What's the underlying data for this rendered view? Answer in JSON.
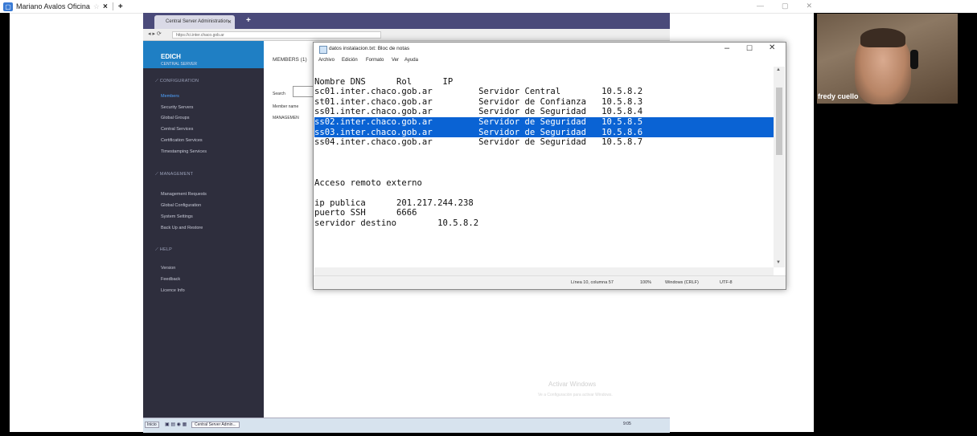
{
  "outer": {
    "tab_title": "Mariano Avalos Oficina",
    "new_tab": "+",
    "close": "×"
  },
  "remote_browser": {
    "tab_title": "Central Server Administration",
    "url": "https://ci.inter.chaco.gob.ar",
    "brand_title": "EDICH",
    "brand_subtitle": "CENTRAL SERVER",
    "sections": [
      {
        "title": "CONFIGURATION",
        "items": [
          "Members",
          "Security Servers",
          "Global Groups",
          "Central Services",
          "Certification Services",
          "Timestamping Services"
        ]
      },
      {
        "title": "MANAGEMENT",
        "items": [
          "Management Requests",
          "Global Configuration",
          "System Settings",
          "Back Up and Restore"
        ]
      },
      {
        "title": "HELP",
        "items": [
          "Version",
          "Feedback",
          "Licence Info"
        ]
      }
    ],
    "page_title": "MEMBERS (1)",
    "search_label": "Search",
    "column_member": "Member name",
    "row_text": "MANAGEMEN",
    "watermark_title": "Activar Windows",
    "watermark_sub": "Ve a Configuración para activar Windows.",
    "taskbar": {
      "start": "Inicio",
      "app": "Central Server Admin...",
      "clock": "9:05"
    }
  },
  "notepad": {
    "title": "datos instalacion.txt: Bloc de notas",
    "menu": [
      "Archivo",
      "Edición",
      "Formato",
      "Ver",
      "Ayuda"
    ],
    "lines": [
      "",
      "Nombre DNS      Rol      IP",
      "sc01.inter.chaco.gob.ar         Servidor Central        10.5.8.2",
      "st01.inter.chaco.gob.ar         Servidor de Confianza   10.5.8.3",
      "ss01.inter.chaco.gob.ar         Servidor de Seguridad   10.5.8.4",
      "ss02.inter.chaco.gob.ar         Servidor de Seguridad   10.5.8.5",
      "ss03.inter.chaco.gob.ar         Servidor de Seguridad   10.5.8.6",
      "ss04.inter.chaco.gob.ar         Servidor de Seguridad   10.5.8.7",
      "",
      "",
      "",
      "Acceso remoto externo",
      "",
      "ip publica      201.217.244.238",
      "puerto SSH      6666",
      "servidor destino        10.5.8.2"
    ],
    "selected_lines": [
      5,
      6
    ],
    "status": {
      "position": "Línea 10, columna 57",
      "zoom": "100%",
      "line_endings": "Windows (CRLF)",
      "encoding": "UTF-8"
    }
  },
  "video": {
    "participant_name": "fredy cuello"
  }
}
